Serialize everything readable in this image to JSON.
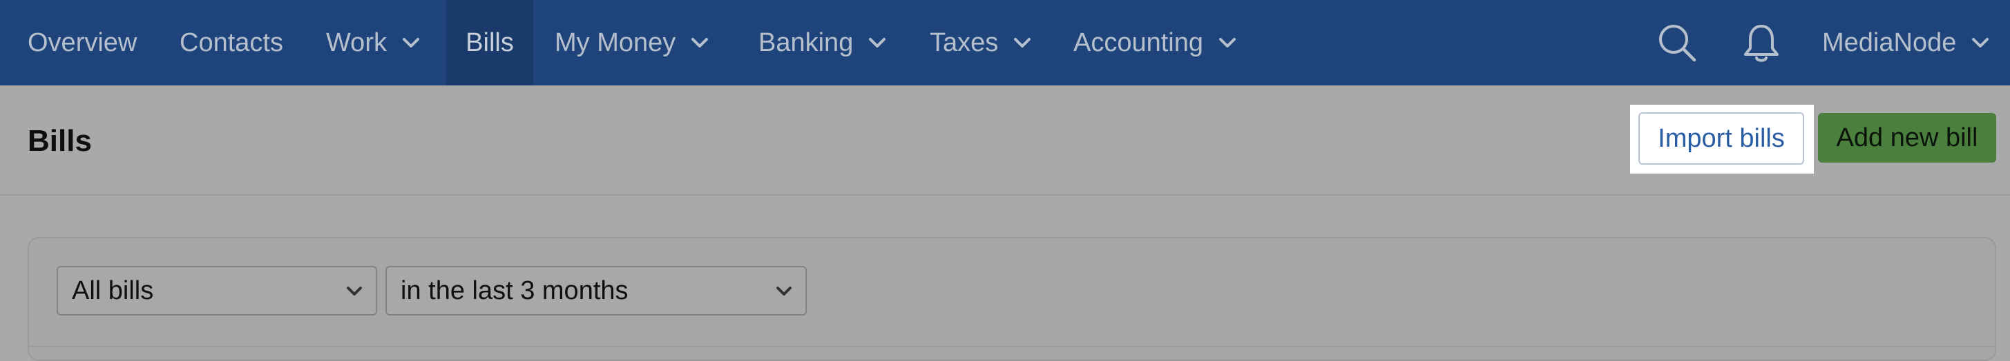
{
  "nav": {
    "overview": "Overview",
    "contacts": "Contacts",
    "work": "Work",
    "bills": "Bills",
    "my_money": "My Money",
    "banking": "Banking",
    "taxes": "Taxes",
    "accounting": "Accounting",
    "account_name": "MediaNode",
    "icons": [
      "search-icon",
      "bell-icon"
    ]
  },
  "header": {
    "title": "Bills",
    "import_label": "Import bills",
    "add_label": "Add new bill"
  },
  "filters": {
    "bill_type": "All bills",
    "date_range": "in the last 3 months"
  },
  "colors": {
    "nav_bg": "#1f447b",
    "nav_active": "#193a6a",
    "add_button": "#4a7f3e",
    "import_text": "#2a5ca4"
  }
}
